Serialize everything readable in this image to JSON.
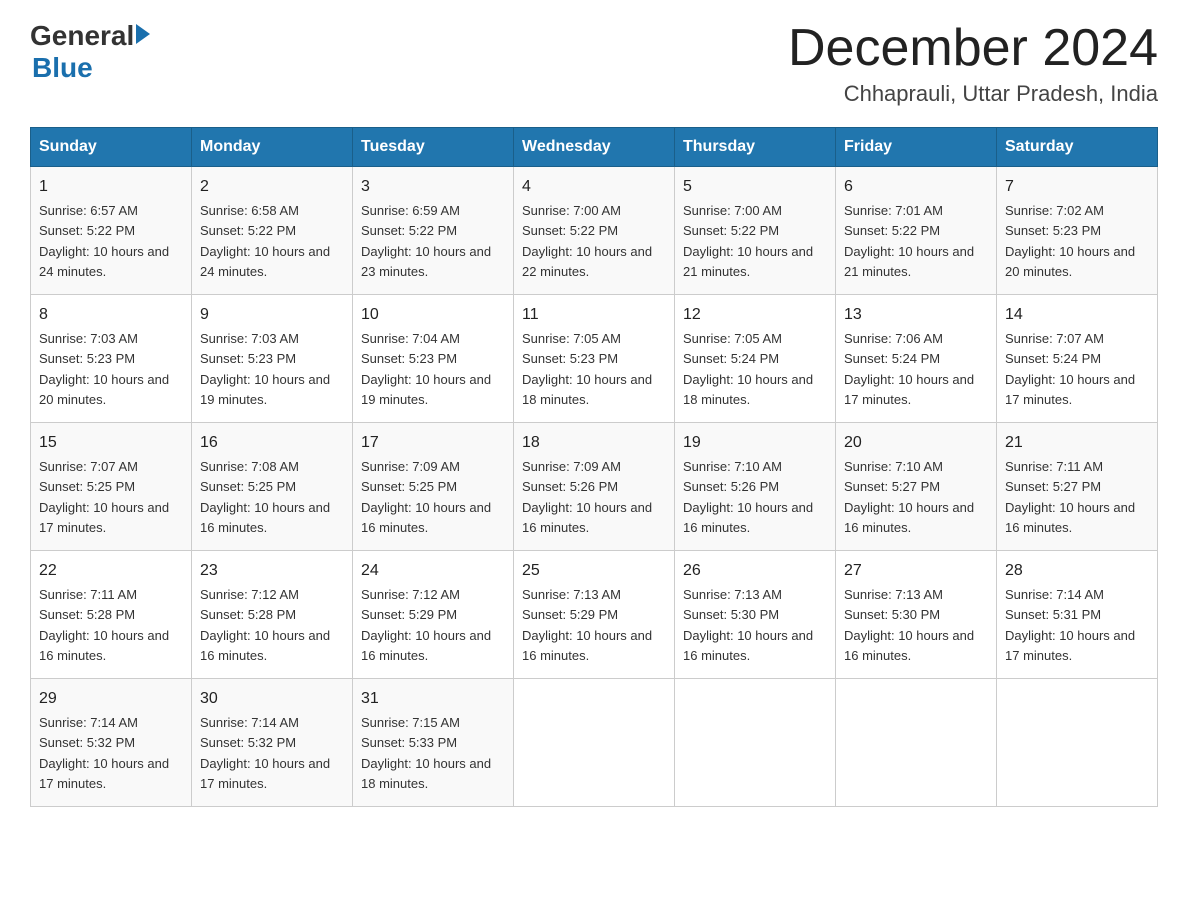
{
  "header": {
    "logo_general": "General",
    "logo_blue": "Blue",
    "month_year": "December 2024",
    "location": "Chhaprauli, Uttar Pradesh, India"
  },
  "weekdays": [
    "Sunday",
    "Monday",
    "Tuesday",
    "Wednesday",
    "Thursday",
    "Friday",
    "Saturday"
  ],
  "weeks": [
    [
      {
        "day": "1",
        "sunrise": "6:57 AM",
        "sunset": "5:22 PM",
        "daylight": "10 hours and 24 minutes."
      },
      {
        "day": "2",
        "sunrise": "6:58 AM",
        "sunset": "5:22 PM",
        "daylight": "10 hours and 24 minutes."
      },
      {
        "day": "3",
        "sunrise": "6:59 AM",
        "sunset": "5:22 PM",
        "daylight": "10 hours and 23 minutes."
      },
      {
        "day": "4",
        "sunrise": "7:00 AM",
        "sunset": "5:22 PM",
        "daylight": "10 hours and 22 minutes."
      },
      {
        "day": "5",
        "sunrise": "7:00 AM",
        "sunset": "5:22 PM",
        "daylight": "10 hours and 21 minutes."
      },
      {
        "day": "6",
        "sunrise": "7:01 AM",
        "sunset": "5:22 PM",
        "daylight": "10 hours and 21 minutes."
      },
      {
        "day": "7",
        "sunrise": "7:02 AM",
        "sunset": "5:23 PM",
        "daylight": "10 hours and 20 minutes."
      }
    ],
    [
      {
        "day": "8",
        "sunrise": "7:03 AM",
        "sunset": "5:23 PM",
        "daylight": "10 hours and 20 minutes."
      },
      {
        "day": "9",
        "sunrise": "7:03 AM",
        "sunset": "5:23 PM",
        "daylight": "10 hours and 19 minutes."
      },
      {
        "day": "10",
        "sunrise": "7:04 AM",
        "sunset": "5:23 PM",
        "daylight": "10 hours and 19 minutes."
      },
      {
        "day": "11",
        "sunrise": "7:05 AM",
        "sunset": "5:23 PM",
        "daylight": "10 hours and 18 minutes."
      },
      {
        "day": "12",
        "sunrise": "7:05 AM",
        "sunset": "5:24 PM",
        "daylight": "10 hours and 18 minutes."
      },
      {
        "day": "13",
        "sunrise": "7:06 AM",
        "sunset": "5:24 PM",
        "daylight": "10 hours and 17 minutes."
      },
      {
        "day": "14",
        "sunrise": "7:07 AM",
        "sunset": "5:24 PM",
        "daylight": "10 hours and 17 minutes."
      }
    ],
    [
      {
        "day": "15",
        "sunrise": "7:07 AM",
        "sunset": "5:25 PM",
        "daylight": "10 hours and 17 minutes."
      },
      {
        "day": "16",
        "sunrise": "7:08 AM",
        "sunset": "5:25 PM",
        "daylight": "10 hours and 16 minutes."
      },
      {
        "day": "17",
        "sunrise": "7:09 AM",
        "sunset": "5:25 PM",
        "daylight": "10 hours and 16 minutes."
      },
      {
        "day": "18",
        "sunrise": "7:09 AM",
        "sunset": "5:26 PM",
        "daylight": "10 hours and 16 minutes."
      },
      {
        "day": "19",
        "sunrise": "7:10 AM",
        "sunset": "5:26 PM",
        "daylight": "10 hours and 16 minutes."
      },
      {
        "day": "20",
        "sunrise": "7:10 AM",
        "sunset": "5:27 PM",
        "daylight": "10 hours and 16 minutes."
      },
      {
        "day": "21",
        "sunrise": "7:11 AM",
        "sunset": "5:27 PM",
        "daylight": "10 hours and 16 minutes."
      }
    ],
    [
      {
        "day": "22",
        "sunrise": "7:11 AM",
        "sunset": "5:28 PM",
        "daylight": "10 hours and 16 minutes."
      },
      {
        "day": "23",
        "sunrise": "7:12 AM",
        "sunset": "5:28 PM",
        "daylight": "10 hours and 16 minutes."
      },
      {
        "day": "24",
        "sunrise": "7:12 AM",
        "sunset": "5:29 PM",
        "daylight": "10 hours and 16 minutes."
      },
      {
        "day": "25",
        "sunrise": "7:13 AM",
        "sunset": "5:29 PM",
        "daylight": "10 hours and 16 minutes."
      },
      {
        "day": "26",
        "sunrise": "7:13 AM",
        "sunset": "5:30 PM",
        "daylight": "10 hours and 16 minutes."
      },
      {
        "day": "27",
        "sunrise": "7:13 AM",
        "sunset": "5:30 PM",
        "daylight": "10 hours and 16 minutes."
      },
      {
        "day": "28",
        "sunrise": "7:14 AM",
        "sunset": "5:31 PM",
        "daylight": "10 hours and 17 minutes."
      }
    ],
    [
      {
        "day": "29",
        "sunrise": "7:14 AM",
        "sunset": "5:32 PM",
        "daylight": "10 hours and 17 minutes."
      },
      {
        "day": "30",
        "sunrise": "7:14 AM",
        "sunset": "5:32 PM",
        "daylight": "10 hours and 17 minutes."
      },
      {
        "day": "31",
        "sunrise": "7:15 AM",
        "sunset": "5:33 PM",
        "daylight": "10 hours and 18 minutes."
      },
      null,
      null,
      null,
      null
    ]
  ],
  "labels": {
    "sunrise_prefix": "Sunrise: ",
    "sunset_prefix": "Sunset: ",
    "daylight_prefix": "Daylight: "
  }
}
